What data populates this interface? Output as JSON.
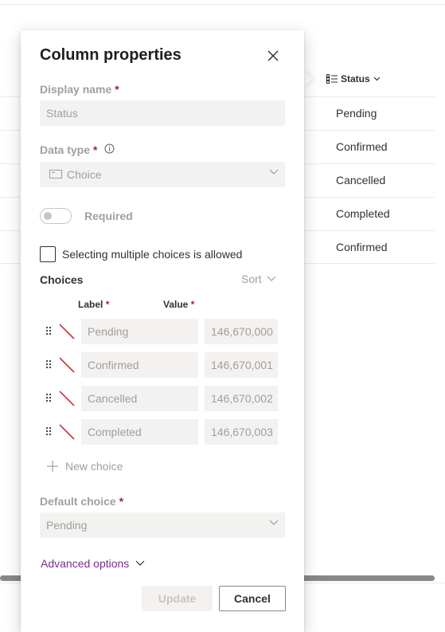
{
  "background": {
    "column_header": "Status",
    "rows": [
      "Pending",
      "Confirmed",
      "Cancelled",
      "Completed",
      "Confirmed"
    ]
  },
  "panel": {
    "title": "Column properties",
    "display_name": {
      "label": "Display name",
      "required_mark": "*",
      "value": "Status"
    },
    "data_type": {
      "label": "Data type",
      "required_mark": "*",
      "value": "Choice"
    },
    "required_toggle": {
      "label": "Required",
      "on": false
    },
    "multi_choice": {
      "label": "Selecting multiple choices is allowed",
      "checked": false
    },
    "choices": {
      "title": "Choices",
      "sort_label": "Sort",
      "label_header": "Label",
      "value_header": "Value",
      "required_mark": "*",
      "items": [
        {
          "label": "Pending",
          "value": "146,670,000"
        },
        {
          "label": "Confirmed",
          "value": "146,670,001"
        },
        {
          "label": "Cancelled",
          "value": "146,670,002"
        },
        {
          "label": "Completed",
          "value": "146,670,003"
        }
      ],
      "new_choice_label": "New choice"
    },
    "default_choice": {
      "label": "Default choice",
      "required_mark": "*",
      "value": "Pending"
    },
    "advanced_options_label": "Advanced options",
    "update_label": "Update",
    "cancel_label": "Cancel"
  },
  "colors": {
    "required": "#a4262c",
    "link": "#7a2c8f",
    "swatch_none": "#d13438"
  }
}
